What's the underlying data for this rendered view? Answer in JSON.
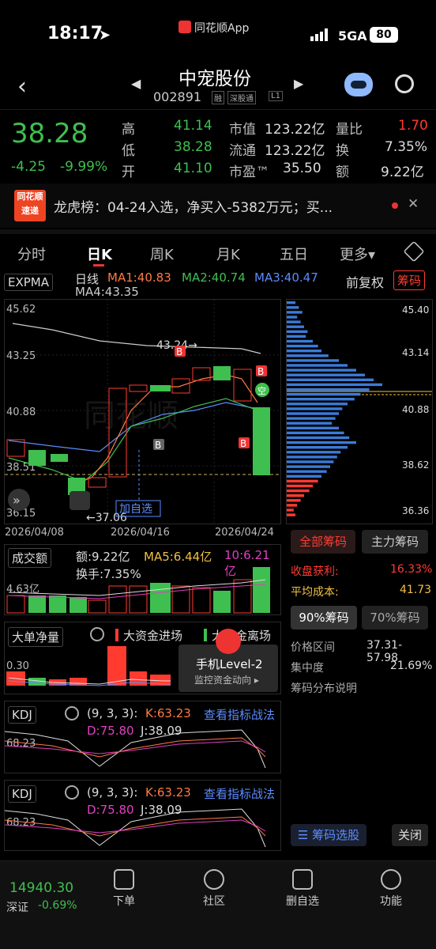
{
  "status": {
    "time": "18:17",
    "app": "同花顺App",
    "network": "5GA",
    "battery": "80"
  },
  "header": {
    "name": "中宠股份",
    "code": "002891",
    "tags": [
      "融",
      "深股通",
      "L1"
    ]
  },
  "quote": {
    "price": "38.28",
    "change": "-4.25",
    "pct": "-9.99%",
    "fields": [
      {
        "k": "高",
        "v": "41.14"
      },
      {
        "k": "低",
        "v": "38.28"
      },
      {
        "k": "开",
        "v": "41.10"
      },
      {
        "k": "市值",
        "v": "123.22亿"
      },
      {
        "k": "流通",
        "v": "123.22亿"
      },
      {
        "k": "市盈™",
        "v": "35.50"
      },
      {
        "k": "量比",
        "v": "1.70"
      },
      {
        "k": "换",
        "v": "7.35%"
      },
      {
        "k": "额",
        "v": "9.22亿"
      }
    ]
  },
  "news": {
    "badge_top": "同花顺",
    "badge_bottom": "速递",
    "text": "龙虎榜：04-24入选，净买入-5382万元；买..."
  },
  "tabs": [
    "分时",
    "日K",
    "周K",
    "月K",
    "五日",
    "更多▾"
  ],
  "kline": {
    "indicator": "EXPMA",
    "period": "日线",
    "ma1": "MA1:40.83",
    "ma2": "MA2:40.74",
    "ma3": "MA3:40.47",
    "ma4": "MA4:43.35",
    "adjust": "前复权",
    "chips_btn": "筹码",
    "ticks": [
      "45.62",
      "43.25",
      "40.88",
      "38.51",
      "36.15"
    ],
    "dates": [
      "2026/04/08",
      "2026/04/16",
      "2026/04/24"
    ],
    "hi_label": "43.24→",
    "lo_label": "←37.06",
    "add": "加自选",
    "watermark": "同花顺"
  },
  "volume": {
    "name": "成交额",
    "amt": "额:9.22亿",
    "ma5": "MA5:6.44亿",
    "ma10": "10:6.21亿",
    "turnover": "换手:7.35%",
    "tick": "4.63亿"
  },
  "bigorder": {
    "name": "大单净量",
    "in": "大资金进场",
    "out": "大资金离场",
    "tick": "0.30",
    "promo_title": "手机Level-2",
    "promo_sub": "监控资金动向 ▸"
  },
  "kdj1": {
    "name": "KDJ",
    "params": "(9, 3, 3):",
    "k": "K:63.23",
    "d": "D:75.80",
    "j": "J:38.09",
    "link": "查看指标战法",
    "tick": "68.23"
  },
  "kdj2": {
    "name": "KDJ",
    "params": "(9, 3, 3):",
    "k": "K:63.23",
    "d": "D:75.80",
    "j": "J:38.09",
    "link": "查看指标战法",
    "tick": "68.23"
  },
  "chips": {
    "ticks": [
      "45.40",
      "43.14",
      "40.88",
      "38.62",
      "36.36"
    ],
    "tab_all": "全部筹码",
    "tab_main": "主力筹码",
    "profit_k": "收盘获利:",
    "profit_v": "16.33%",
    "cost_k": "平均成本:",
    "cost_v": "41.73",
    "c90": "90%筹码",
    "c70": "70%筹码",
    "range_k": "价格区间",
    "range_v": "37.31-57.98",
    "conc_k": "集中度",
    "conc_v": "21.69%",
    "explain": "筹码分布说明",
    "select": "筹码选股",
    "close": "关闭"
  },
  "bottom": {
    "index_val": "14940.30",
    "index_name": "深证",
    "index_pct": "-0.69%",
    "items": [
      "下单",
      "社区",
      "删自选",
      "功能"
    ]
  },
  "chart_data": {
    "type": "candlestick",
    "x": [
      "2026/04/08",
      "2026/04/16",
      "2026/04/24"
    ],
    "y_ticks": [
      45.62,
      43.25,
      40.88,
      38.51,
      36.15
    ],
    "high_marker": 43.24,
    "low_marker": 37.06,
    "last_close": 38.28
  }
}
